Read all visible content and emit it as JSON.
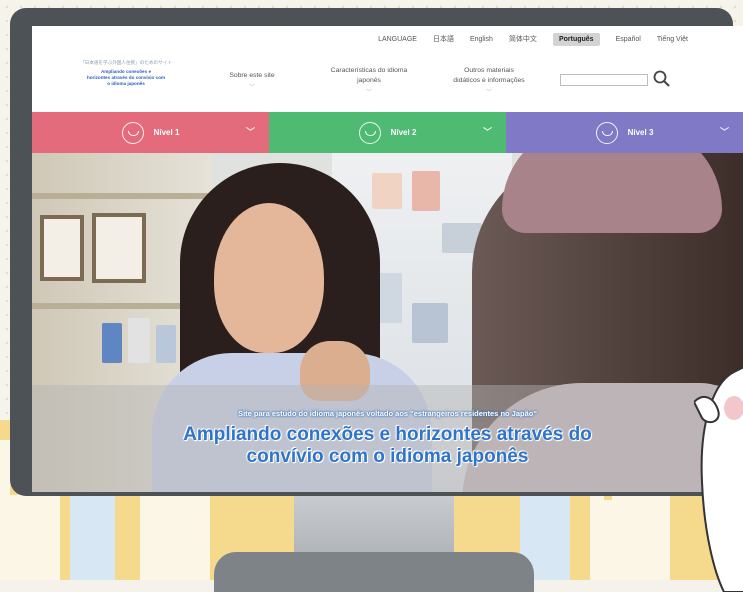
{
  "language_bar": {
    "items": [
      "LANGUAGE",
      "日本語",
      "English",
      "简体中文",
      "Português",
      "Español",
      "Tiếng Việt"
    ],
    "active_index": 4
  },
  "header": {
    "logo": {
      "tagline": "「日本語を学ぶ外国人住民」のためのサイト",
      "name_line1": "Ampliando conexões e",
      "name_line2": "horizontes através do convívio com",
      "name_line3": "o idioma japonês"
    },
    "nav": [
      {
        "label_line1": "Sobre este site",
        "label_line2": ""
      },
      {
        "label_line1": "Características do idioma",
        "label_line2": "japonês"
      },
      {
        "label_line1": "Outros materiais",
        "label_line2": "didáticos e informações"
      }
    ],
    "search": {
      "placeholder": ""
    }
  },
  "levels": [
    {
      "label": "Nível 1",
      "color": "#e36b7c"
    },
    {
      "label": "Nível 2",
      "color": "#4fba72"
    },
    {
      "label": "Nível 3",
      "color": "#7f79c6"
    }
  ],
  "hero": {
    "subtitle": "Site para estudo do idioma japonês voltado aos \"estrangeiros residentes no Japão\"",
    "title_line1": "Ampliando conexões e horizontes através do",
    "title_line2": "convívio com o idioma japonês"
  },
  "icons": [
    "search-icon",
    "chevron-down-icon",
    "level-icon",
    "cat-mascot"
  ]
}
